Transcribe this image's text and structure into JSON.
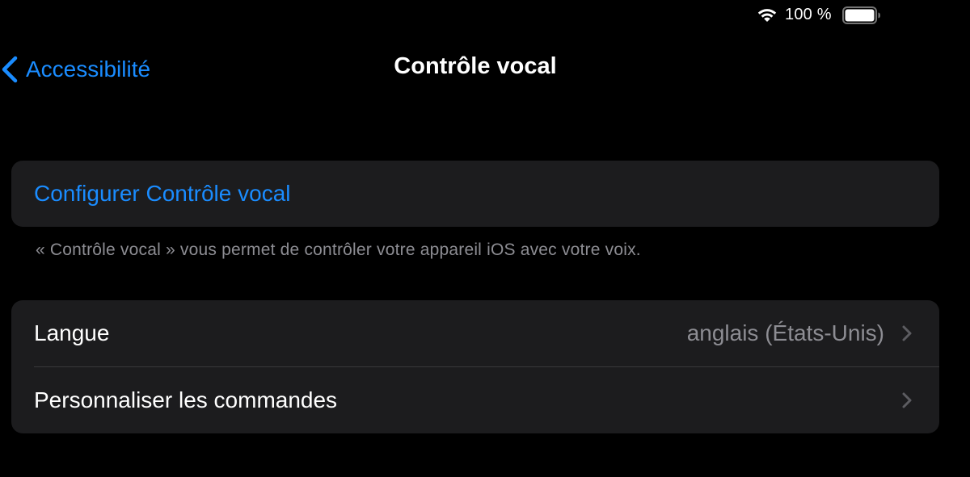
{
  "status_bar": {
    "battery_percent": "100 %",
    "battery_level": 1.0,
    "wifi_icon": "wifi-icon",
    "battery_icon": "battery-full-icon"
  },
  "nav": {
    "back_label": "Accessibilité",
    "back_icon": "chevron-left-icon",
    "title": "Contrôle vocal"
  },
  "setup_group": {
    "button_label": "Configurer Contrôle vocal",
    "footer": "« Contrôle vocal » vous permet de contrôler votre appareil iOS avec votre voix."
  },
  "settings_group": {
    "rows": [
      {
        "label": "Langue",
        "value": "anglais (États-Unis)",
        "icon": "chevron-right-icon"
      },
      {
        "label": "Personnaliser les commandes",
        "value": "",
        "icon": "chevron-right-icon"
      }
    ]
  },
  "colors": {
    "background": "#000000",
    "cell_background": "#1c1c1e",
    "accent": "#1a8cff",
    "secondary_text": "#8d8d93",
    "separator": "#38383a",
    "chevron": "#5c5c61"
  }
}
